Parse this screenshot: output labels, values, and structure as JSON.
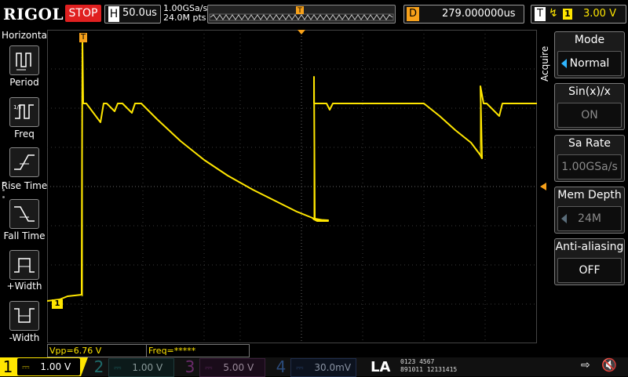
{
  "header": {
    "brand": "RIGOL",
    "run_state": "STOP",
    "horizontal": {
      "label": "H",
      "value": "50.0us"
    },
    "sample_rate": "1.00GSa/s",
    "memory_points": "24.0M pts",
    "delay": {
      "label": "D",
      "value": "279.000000us"
    },
    "trigger": {
      "label": "T",
      "edge_icon": "rising-edge-icon",
      "channel": "1",
      "level": "3.00 V"
    }
  },
  "left_menu": {
    "title": "Horizontal",
    "items": [
      {
        "label": "Period",
        "icon": "period-icon"
      },
      {
        "label": "Freq",
        "icon": "freq-icon"
      },
      {
        "label": "Rise Time",
        "icon": "rise-time-icon"
      },
      {
        "label": "Fall Time",
        "icon": "fall-time-icon"
      },
      {
        "label": "+Width",
        "icon": "plus-width-icon"
      },
      {
        "label": "-Width",
        "icon": "minus-width-icon"
      }
    ]
  },
  "right_menu": {
    "section": "Acquire",
    "items": [
      {
        "title": "Mode",
        "value": "Normal",
        "active": true
      },
      {
        "title": "Sin(x)/x",
        "value": "ON",
        "active": false
      },
      {
        "title": "Sa Rate",
        "value": "1.00GSa/s",
        "active": false
      },
      {
        "title": "Mem Depth",
        "value": "24M",
        "active": false
      },
      {
        "title": "Anti-aliasing",
        "value": "OFF",
        "active": true
      }
    ]
  },
  "markers": {
    "trigger_marker": "T",
    "channel_marker": "1"
  },
  "measurements": {
    "vpp": "Vpp=6.76 V",
    "freq": "Freq=*****"
  },
  "channels": [
    {
      "num": "1",
      "scale": "1.00 V",
      "color": "#ffe600",
      "active": true
    },
    {
      "num": "2",
      "scale": "1.00 V",
      "color": "#00c8c8",
      "active": false
    },
    {
      "num": "3",
      "scale": "5.00 V",
      "color": "#d04dd0",
      "active": false
    },
    {
      "num": "4",
      "scale": "30.0mV",
      "color": "#2f7fff",
      "active": false
    }
  ],
  "logic_analyzer": {
    "label": "LA",
    "row1": "0123 4567",
    "row2": "891011 12131415"
  },
  "status_icons": [
    "usb-icon",
    "speaker-muted-icon"
  ],
  "colors": {
    "ch1": "#ffe600",
    "trigger": "#f7a11a",
    "stop": "#e02020",
    "accent": "#2fb5ff"
  }
}
